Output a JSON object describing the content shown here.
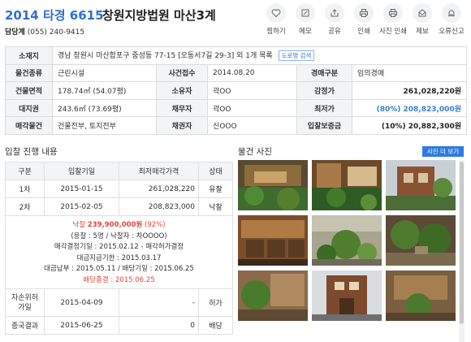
{
  "header": {
    "case_no": "2014 타경 6615",
    "court": "창원지방법원 마산3계",
    "manager_label": "담당계",
    "manager_phone": "(055) 240-9415"
  },
  "toolbar": [
    {
      "label": "찜하기",
      "icon": "heart-icon"
    },
    {
      "label": "메모",
      "icon": "memo-icon"
    },
    {
      "label": "공유",
      "icon": "share-icon"
    },
    {
      "label": "인쇄",
      "icon": "print-icon"
    },
    {
      "label": "사진 인쇄",
      "icon": "photo-print-icon"
    },
    {
      "label": "제보",
      "icon": "report-icon"
    },
    {
      "label": "오류신고",
      "icon": "error-report-icon"
    }
  ],
  "info": {
    "location_label": "소재지",
    "location_value": "경남 창원시 마산합포구 중성동 77-15 [오동서7길 29-3] 외 1개 목록",
    "map_button": "도로명 검색",
    "type_label": "물건종류",
    "type_value": "근린시설",
    "received_label": "사건접수",
    "received_value": "2014.08.20",
    "auction_type_label": "경매구분",
    "auction_type_value": "임의경매",
    "area_label": "건물면적",
    "area_value": "178.74㎡ (54.07평)",
    "owner_label": "소유자",
    "owner_value": "곽OO",
    "appraisal_label": "감정가",
    "appraisal_value": "261,028,220원",
    "land_label": "대지권",
    "land_value": "243.6㎡ (73.69평)",
    "debtor_label": "채무자",
    "debtor_value": "곽OO",
    "min_price_label": "최저가",
    "min_price_value": "(80%) 208,823,000원",
    "sale_item_label": "매각물건",
    "sale_item_value": "건물전부, 토지전부",
    "creditor_label": "채권자",
    "creditor_value": "신OOO",
    "deposit_label": "입찰보증금",
    "deposit_value": "(10%) 20,882,300원"
  },
  "bid_section": {
    "title": "입찰 진행 내용",
    "headers": [
      "구분",
      "입찰기일",
      "최저매각가격",
      "상태"
    ],
    "rows": [
      {
        "round": "1차",
        "date": "2015-01-15",
        "price": "261,028,220",
        "status": "유찰"
      },
      {
        "round": "2차",
        "date": "2015-02-05",
        "price": "208,823,000",
        "status": "낙찰"
      }
    ],
    "detail": {
      "winning_label": "낙찰",
      "winning_price": "239,900,000원",
      "winning_pct": "(92%)",
      "bidders": "(응찰 : 5명 / 낙찰자 : 차OOOO)",
      "decision": "매각결정기일 : 2015.02.12 - 매각허가결정",
      "due": "대금지급기한 : 2015.03.17",
      "paid": "대금납부 : 2015.05.11 / 배당기일 : 2015.06.25",
      "finished": "배당종결 : 2015.06.25"
    },
    "rows2": [
      {
        "round": "자손위허가일",
        "date": "2015-04-09",
        "price": "-",
        "status": "허가"
      },
      {
        "round": "종국결과",
        "date": "2015-06-25",
        "price": "0",
        "status": "배당"
      }
    ]
  },
  "photo_section": {
    "title": "물건 사진",
    "more_button": "사진 더 보기"
  }
}
